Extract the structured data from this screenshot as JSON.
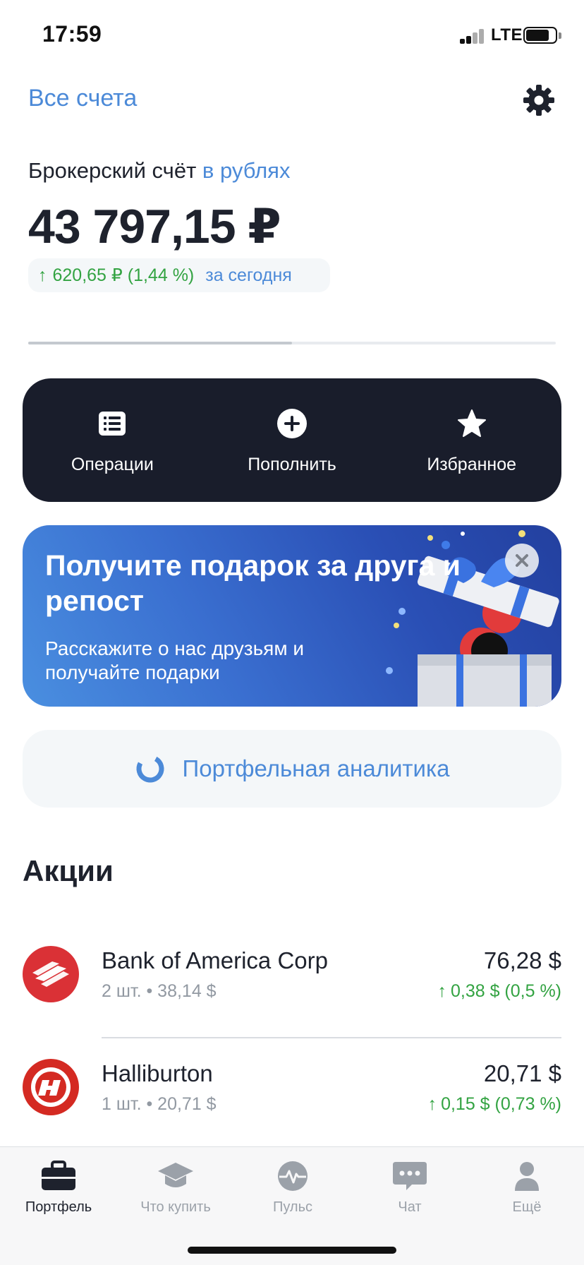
{
  "status": {
    "time": "17:59",
    "network": "LTE",
    "battery_level": 0.8
  },
  "header": {
    "all_accounts": "Все счета",
    "settings_icon": "gear-icon"
  },
  "account": {
    "type": "Брокерский счёт",
    "currency": "в рублях",
    "balance": "43 797,15 ₽",
    "change_arrow": "↑",
    "change_value": "620,65 ₽ (1,44 %)",
    "change_period": "за сегодня",
    "progress": 0.5
  },
  "actions": [
    {
      "label": "Операции",
      "icon": "list-icon"
    },
    {
      "label": "Пополнить",
      "icon": "plus-circle-icon"
    },
    {
      "label": "Избранное",
      "icon": "star-icon"
    }
  ],
  "promo": {
    "title": "Получите подарок за друга и репост",
    "text": "Расскажите о нас друзьям и получайте подарки",
    "close_icon": "close-icon"
  },
  "analytics": {
    "label": "Портфельная аналитика",
    "icon": "donut-chart-icon"
  },
  "stocks_section": {
    "title": "Акции",
    "items": [
      {
        "name": "Bank of America Corp",
        "qty": "2 шт. • 38,14 $",
        "price": "76,28 $",
        "change_arrow": "↑",
        "change": "0,38 $ (0,5 %)",
        "logo": "bank-of-america-logo"
      },
      {
        "name": "Halliburton",
        "qty": "1 шт. • 20,71 $",
        "price": "20,71 $",
        "change_arrow": "↑",
        "change": "0,15 $ (0,73 %)",
        "logo": "halliburton-logo"
      }
    ]
  },
  "tabs": [
    {
      "label": "Портфель",
      "icon": "briefcase-icon",
      "active": true
    },
    {
      "label": "Что купить",
      "icon": "graduation-cap-icon",
      "active": false
    },
    {
      "label": "Пульс",
      "icon": "pulse-icon",
      "active": false
    },
    {
      "label": "Чат",
      "icon": "chat-icon",
      "active": false
    },
    {
      "label": "Ещё",
      "icon": "profile-icon",
      "active": false
    }
  ],
  "colors": {
    "accent": "#4c8ad8",
    "positive": "#33a342",
    "dark": "#191d2b",
    "text": "#1e222d",
    "muted": "#9299a2"
  }
}
